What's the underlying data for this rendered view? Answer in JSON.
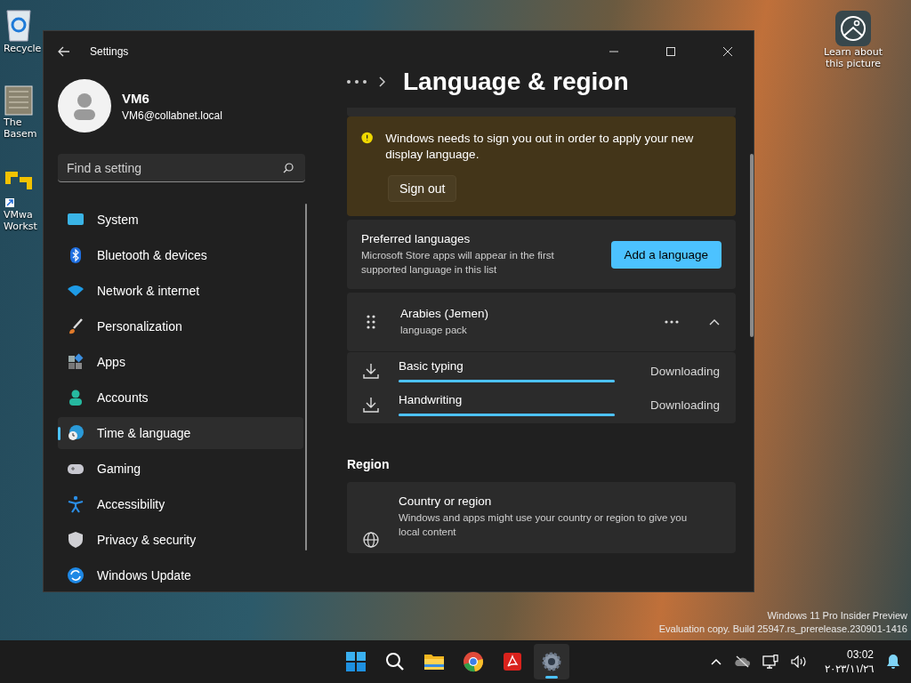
{
  "desktop": {
    "icons": [
      {
        "kind": "recycle",
        "lines": [
          "Recycle"
        ]
      },
      {
        "kind": "image",
        "lines": [
          "The",
          "Basem"
        ]
      },
      {
        "kind": "vmware",
        "lines": [
          "VMwa",
          "Workst"
        ]
      }
    ],
    "learn_picture": {
      "lines": [
        "Learn about",
        "this picture"
      ]
    },
    "watermark": [
      "Windows 11 Pro Insider Preview",
      "Evaluation copy. Build 25947.rs_prerelease.230901-1416"
    ]
  },
  "window": {
    "title": "Settings"
  },
  "user": {
    "name": "VM6",
    "email": "VM6@collabnet.local"
  },
  "search": {
    "placeholder": "Find a setting"
  },
  "nav": [
    {
      "kind": "system",
      "label": "System",
      "selected": false
    },
    {
      "kind": "bluetooth",
      "label": "Bluetooth & devices",
      "selected": false
    },
    {
      "kind": "network",
      "label": "Network & internet",
      "selected": false
    },
    {
      "kind": "brush",
      "label": "Personalization",
      "selected": false
    },
    {
      "kind": "apps",
      "label": "Apps",
      "selected": false
    },
    {
      "kind": "accounts",
      "label": "Accounts",
      "selected": false
    },
    {
      "kind": "time",
      "label": "Time & language",
      "selected": true
    },
    {
      "kind": "gaming",
      "label": "Gaming",
      "selected": false
    },
    {
      "kind": "accessibility",
      "label": "Accessibility",
      "selected": false
    },
    {
      "kind": "privacy",
      "label": "Privacy & security",
      "selected": false
    },
    {
      "kind": "update",
      "label": "Windows Update",
      "selected": false
    }
  ],
  "page": {
    "title": "Language & region"
  },
  "warning": {
    "message": "Windows needs to sign you out in order to apply your new display language.",
    "button": "Sign out"
  },
  "preferred": {
    "title": "Preferred languages",
    "description": "Microsoft Store apps will appear in the first supported language in this list",
    "button": "Add a language"
  },
  "language": {
    "name": "Arabies (Jemen)",
    "subtitle": "language pack",
    "expanded": true,
    "features": [
      {
        "name": "Basic typing",
        "status": "Downloading",
        "level": 1
      },
      {
        "name": "Handwriting",
        "status": "Downloading",
        "level": 1
      }
    ]
  },
  "region": {
    "heading": "Region",
    "items": [
      {
        "title": "Country or region",
        "description": "Windows and apps might use your country or region to give you local content"
      }
    ]
  },
  "taskbar": {
    "apps": [
      {
        "kind": "start",
        "selected": false
      },
      {
        "kind": "search",
        "selected": false
      },
      {
        "kind": "folder",
        "selected": false
      },
      {
        "kind": "browser",
        "selected": false
      },
      {
        "kind": "pdf",
        "selected": false
      },
      {
        "kind": "settings",
        "selected": true
      }
    ],
    "time": "03:02",
    "date": "٢٠٢٣/١١/٢٦"
  }
}
